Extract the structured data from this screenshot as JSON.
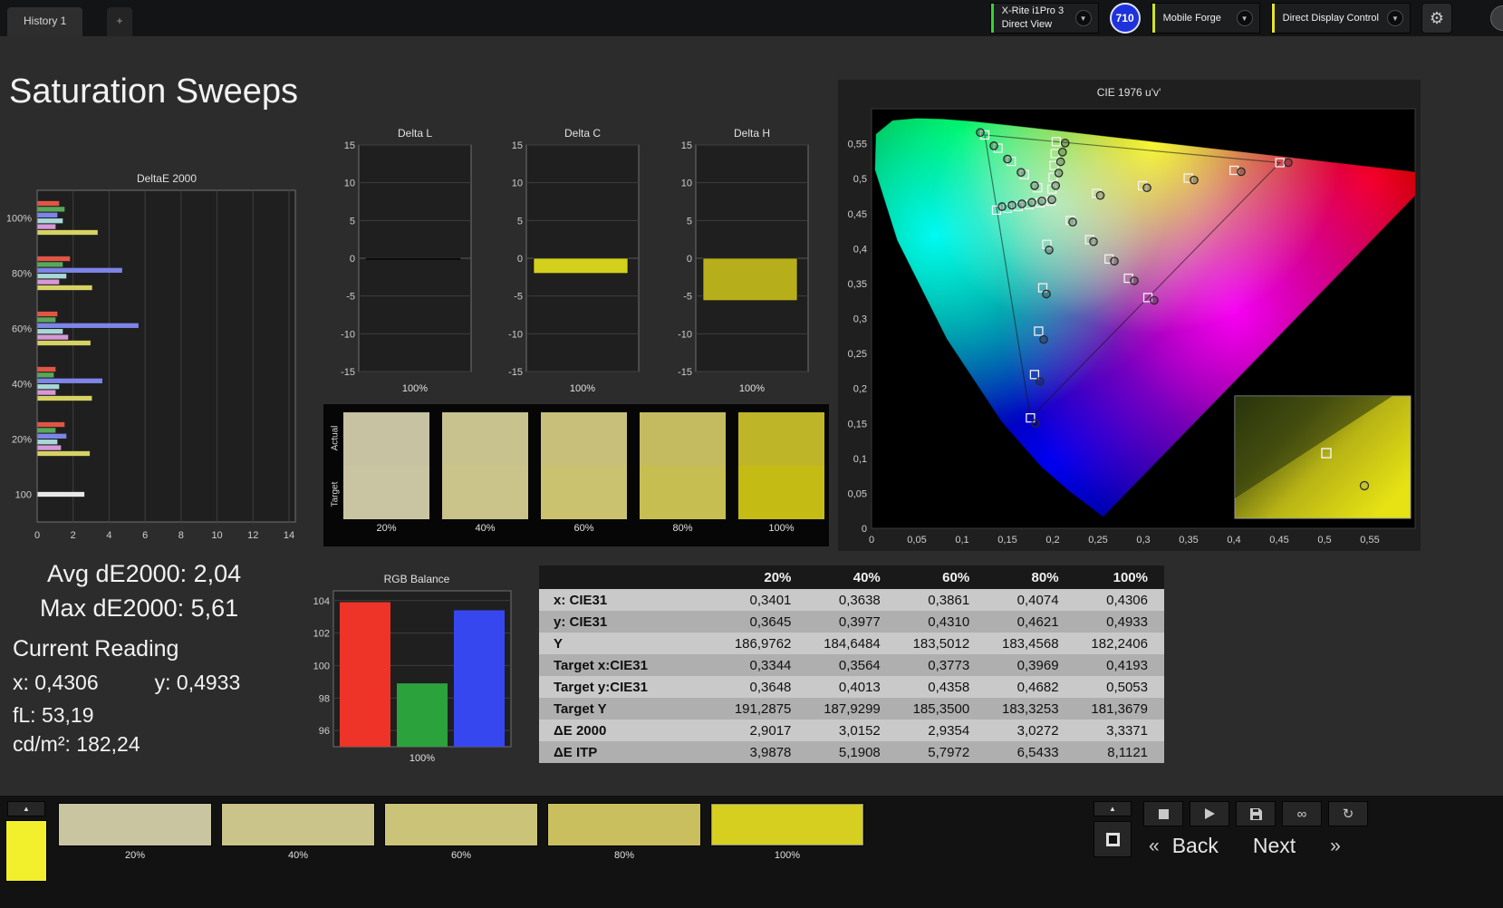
{
  "window": {
    "tab_label": "History 1",
    "new_tab": "+",
    "meter_name": "X-Rite i1Pro 3",
    "meter_mode": "Direct View",
    "meter_badge": "710",
    "source_name": "Mobile Forge",
    "display_control": "Direct Display Control",
    "meter_accent": "#35d435",
    "source_accent": "#cde428",
    "display_accent": "#e8e428"
  },
  "page_title": "Saturation Sweeps",
  "readings": {
    "avg_label": "Avg dE2000: 2,04",
    "max_label": "Max dE2000: 5,61",
    "current_title": "Current Reading",
    "x_label": "x: 0,4306",
    "y_label": "y: 0,4933",
    "fl_label": "fL: 53,19",
    "cd_label": "cd/m²: 182,24"
  },
  "table": {
    "headers": [
      "20%",
      "40%",
      "60%",
      "80%",
      "100%"
    ],
    "rows": [
      {
        "label": "x: CIE31",
        "values": [
          "0,3401",
          "0,3638",
          "0,3861",
          "0,4074",
          "0,4306"
        ]
      },
      {
        "label": "y: CIE31",
        "values": [
          "0,3645",
          "0,3977",
          "0,4310",
          "0,4621",
          "0,4933"
        ]
      },
      {
        "label": "Y",
        "values": [
          "186,9762",
          "184,6484",
          "183,5012",
          "183,4568",
          "182,2406"
        ]
      },
      {
        "label": "Target x:CIE31",
        "values": [
          "0,3344",
          "0,3564",
          "0,3773",
          "0,3969",
          "0,4193"
        ]
      },
      {
        "label": "Target y:CIE31",
        "values": [
          "0,3648",
          "0,4013",
          "0,4358",
          "0,4682",
          "0,5053"
        ]
      },
      {
        "label": "Target Y",
        "values": [
          "191,2875",
          "187,9299",
          "185,3500",
          "183,3253",
          "181,3679"
        ]
      },
      {
        "label": "ΔE 2000",
        "values": [
          "2,9017",
          "3,0152",
          "2,9354",
          "3,0272",
          "3,3371"
        ]
      },
      {
        "label": "ΔE ITP",
        "values": [
          "3,9878",
          "5,1908",
          "5,7972",
          "6,5433",
          "8,1121"
        ]
      }
    ]
  },
  "swatch_strip": {
    "row_labels": [
      "Actual",
      "Target"
    ],
    "items": [
      {
        "label": "20%",
        "actual": "#c6c2a2",
        "target": "#c9c5a3"
      },
      {
        "label": "40%",
        "actual": "#c8c28e",
        "target": "#cac38a"
      },
      {
        "label": "60%",
        "actual": "#c8c07a",
        "target": "#cac26f"
      },
      {
        "label": "80%",
        "actual": "#c4bb60",
        "target": "#c7be52"
      },
      {
        "label": "100%",
        "actual": "#bfb529",
        "target": "#c4bc14"
      }
    ]
  },
  "bottom_bar": {
    "preview_color": "#f2ef2d",
    "swatches": [
      {
        "label": "20%",
        "color": "#c9c5a0"
      },
      {
        "label": "40%",
        "color": "#cac38a"
      },
      {
        "label": "60%",
        "color": "#cbc377"
      },
      {
        "label": "80%",
        "color": "#c9bf5e"
      },
      {
        "label": "100%",
        "color": "#d6cf1f",
        "selected": true
      }
    ],
    "back_label": "Back",
    "next_label": "Next"
  },
  "chart_data": [
    {
      "id": "deltae2000",
      "type": "bar",
      "orientation": "horizontal",
      "title": "DeltaE 2000",
      "xlim": [
        0,
        14
      ],
      "xticks": [
        0,
        2,
        4,
        6,
        8,
        10,
        12,
        14
      ],
      "groups": [
        "100%",
        "80%",
        "60%",
        "40%",
        "20%",
        "100"
      ],
      "series": [
        {
          "name": "red",
          "color": "#e05545",
          "values": [
            1.2,
            1.8,
            1.1,
            1.0,
            1.5,
            null
          ]
        },
        {
          "name": "green",
          "color": "#58a858",
          "values": [
            1.5,
            1.4,
            1.0,
            0.9,
            1.0,
            null
          ]
        },
        {
          "name": "blue",
          "color": "#7d85e8",
          "values": [
            1.1,
            4.7,
            5.61,
            3.6,
            1.6,
            null
          ]
        },
        {
          "name": "cyan",
          "color": "#a8d8d8",
          "values": [
            1.4,
            1.6,
            1.4,
            1.2,
            1.1,
            null
          ]
        },
        {
          "name": "magenta",
          "color": "#d898d8",
          "values": [
            1.0,
            1.2,
            1.7,
            1.0,
            1.3,
            null
          ]
        },
        {
          "name": "yellow",
          "color": "#d6d265",
          "values": [
            3.34,
            3.03,
            2.94,
            3.02,
            2.9,
            null
          ]
        },
        {
          "name": "white",
          "color": "#e8e8e8",
          "values": [
            null,
            null,
            null,
            null,
            null,
            2.6
          ]
        }
      ]
    },
    {
      "id": "deltaL",
      "type": "bar",
      "title": "Delta L",
      "ylim": [
        -15,
        15
      ],
      "yticks": [
        15,
        10,
        5,
        0,
        -5,
        -10,
        -15
      ],
      "categories": [
        "100%"
      ],
      "values": [
        -0.15
      ],
      "color": "#0a0a06"
    },
    {
      "id": "deltaC",
      "type": "bar",
      "title": "Delta C",
      "ylim": [
        -15,
        15
      ],
      "yticks": [
        15,
        10,
        5,
        0,
        -5,
        -10,
        -15
      ],
      "categories": [
        "100%"
      ],
      "values": [
        -2.0
      ],
      "color": "#d3cf1d"
    },
    {
      "id": "deltaH",
      "type": "bar",
      "title": "Delta H",
      "ylim": [
        -15,
        15
      ],
      "yticks": [
        15,
        10,
        5,
        0,
        -5,
        -10,
        -15
      ],
      "categories": [
        "100%"
      ],
      "values": [
        -5.6
      ],
      "color": "#b7ae1c"
    },
    {
      "id": "rgb_balance",
      "type": "bar",
      "title": "RGB Balance",
      "categories": [
        "Red",
        "Green",
        "Blue"
      ],
      "values": [
        103.9,
        98.9,
        103.4
      ],
      "colors": [
        "#ee3428",
        "#2ba23c",
        "#3647f0"
      ],
      "ylim": [
        95,
        104.6
      ],
      "yticks": [
        96,
        98,
        100,
        102,
        104
      ],
      "xlabel": "100%"
    },
    {
      "id": "cie",
      "type": "scatter",
      "title": "CIE 1976 u'v'",
      "xlim": [
        0,
        0.6
      ],
      "ylim": [
        0,
        0.6
      ],
      "xtick_labels": [
        "0",
        "0,05",
        "0,1",
        "0,15",
        "0,2",
        "0,25",
        "0,3",
        "0,35",
        "0,4",
        "0,45",
        "0,5",
        "0,55"
      ],
      "ytick_labels": [
        "0",
        "0,05",
        "0,1",
        "0,15",
        "0,2",
        "0,25",
        "0,3",
        "0,35",
        "0,4",
        "0,45",
        "0,5",
        "0,55"
      ],
      "white_point": [
        0.198,
        0.468
      ],
      "targets": {
        "red": [
          [
            0.2485,
            0.479
          ],
          [
            0.2991,
            0.49
          ],
          [
            0.3496,
            0.5009
          ],
          [
            0.4002,
            0.5119
          ],
          [
            0.4507,
            0.5229
          ]
        ],
        "green": [
          [
            0.1834,
            0.4869
          ],
          [
            0.1688,
            0.5058
          ],
          [
            0.1542,
            0.5247
          ],
          [
            0.1396,
            0.5436
          ],
          [
            0.125,
            0.5625
          ]
        ],
        "blue": [
          [
            0.1935,
            0.406
          ],
          [
            0.189,
            0.344
          ],
          [
            0.1844,
            0.2819
          ],
          [
            0.1799,
            0.2199
          ],
          [
            0.1754,
            0.1579
          ]
        ],
        "cyan": [
          [
            0.186,
            0.4654
          ],
          [
            0.174,
            0.4628
          ],
          [
            0.162,
            0.4602
          ],
          [
            0.15,
            0.4576
          ],
          [
            0.138,
            0.455
          ]
        ],
        "magenta": [
          [
            0.2194,
            0.4404
          ],
          [
            0.2408,
            0.4128
          ],
          [
            0.2622,
            0.3852
          ],
          [
            0.2836,
            0.3576
          ],
          [
            0.305,
            0.33
          ]
        ],
        "yellow": [
          [
            0.1992,
            0.485
          ],
          [
            0.2004,
            0.502
          ],
          [
            0.2015,
            0.5189
          ],
          [
            0.2027,
            0.5359
          ],
          [
            0.2039,
            0.5529
          ]
        ],
        "white": [
          [
            0.198,
            0.468
          ]
        ]
      },
      "measurements": {
        "red": [
          [
            0.2525,
            0.476
          ],
          [
            0.304,
            0.487
          ],
          [
            0.356,
            0.498
          ],
          [
            0.408,
            0.51
          ],
          [
            0.46,
            0.523
          ]
        ],
        "green": [
          [
            0.18,
            0.49
          ],
          [
            0.165,
            0.509
          ],
          [
            0.15,
            0.528
          ],
          [
            0.135,
            0.547
          ],
          [
            0.12,
            0.566
          ]
        ],
        "blue": [
          [
            0.196,
            0.398
          ],
          [
            0.193,
            0.335
          ],
          [
            0.19,
            0.27
          ],
          [
            0.186,
            0.21
          ],
          [
            0.181,
            0.15
          ]
        ],
        "cyan": [
          [
            0.188,
            0.468
          ],
          [
            0.177,
            0.466
          ],
          [
            0.166,
            0.464
          ],
          [
            0.155,
            0.462
          ],
          [
            0.144,
            0.46
          ]
        ],
        "magenta": [
          [
            0.222,
            0.438
          ],
          [
            0.245,
            0.41
          ],
          [
            0.268,
            0.382
          ],
          [
            0.29,
            0.354
          ],
          [
            0.312,
            0.326
          ]
        ],
        "yellow": [
          [
            0.2032,
            0.4901
          ],
          [
            0.2066,
            0.5081
          ],
          [
            0.2087,
            0.5242
          ],
          [
            0.2108,
            0.538
          ],
          [
            0.2137,
            0.5509
          ]
        ],
        "white": [
          [
            0.199,
            0.47
          ]
        ]
      },
      "inset": {
        "square": [
          0.502,
          0.1075
        ],
        "circle": [
          0.544,
          0.061
        ]
      }
    }
  ]
}
